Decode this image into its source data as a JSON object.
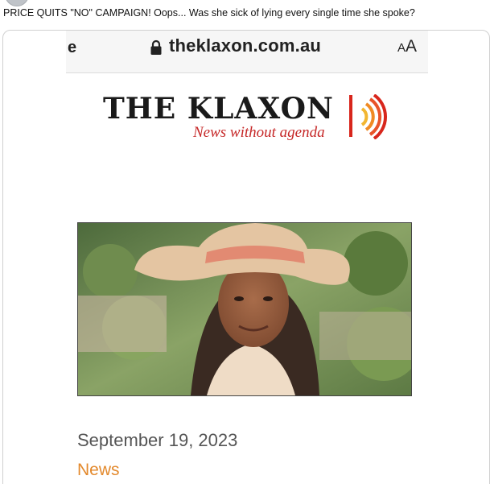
{
  "post": {
    "text": "PRICE QUITS \"NO\" CAMPAIGN! Oops... Was she sick of lying every single time she spoke?"
  },
  "browser": {
    "back_fragment": "e",
    "url": "theklaxon.com.au",
    "text_size_small": "A",
    "text_size_big": "A"
  },
  "site": {
    "title": "THE KLAXON",
    "tagline": "News without agenda",
    "brand_color": "#d8261c",
    "accent_color": "#e3892c"
  },
  "article": {
    "date": "September 19, 2023",
    "category": "News"
  }
}
